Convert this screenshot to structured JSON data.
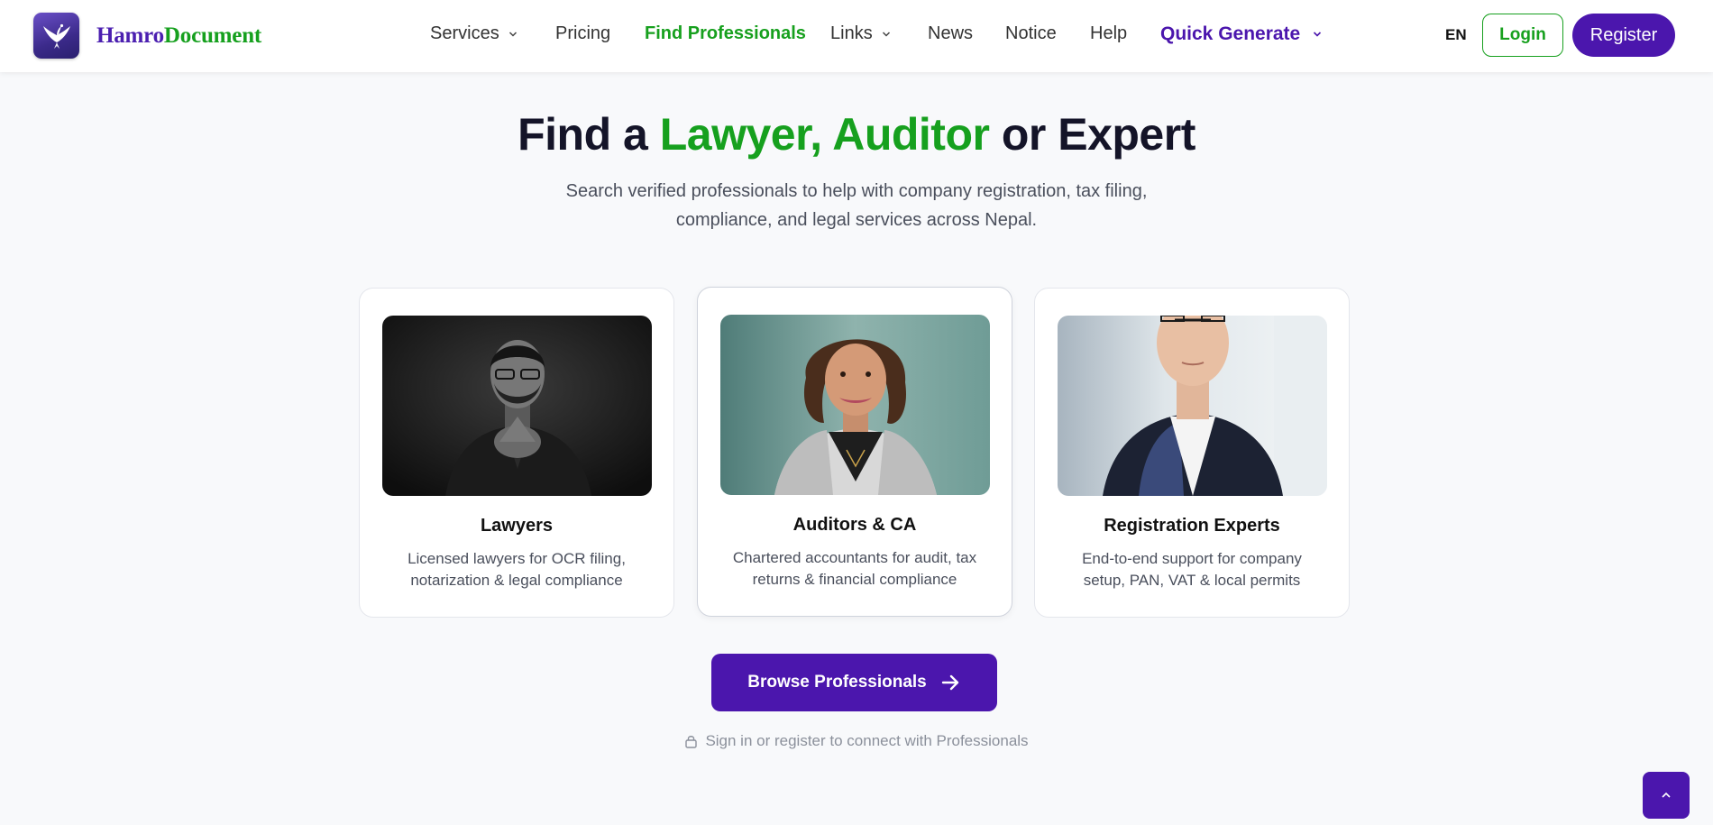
{
  "brand": {
    "name_part1": "Hamro",
    "name_part2": "Document"
  },
  "nav": {
    "services": "Services",
    "pricing": "Pricing",
    "find_professionals": "Find Professionals",
    "links": "Links",
    "news": "News",
    "notice": "Notice",
    "help": "Help",
    "quick_generate": "Quick Generate"
  },
  "header_actions": {
    "language": "EN",
    "login": "Login",
    "register": "Register"
  },
  "hero": {
    "title_part1": "Find a ",
    "title_highlight": "Lawyer, Auditor",
    "title_part2": " or Expert",
    "subtitle": "Search verified professionals to help with company registration, tax filing, compliance, and legal services across Nepal."
  },
  "cards": [
    {
      "title": "Lawyers",
      "description": "Licensed lawyers for OCR filing, notarization & legal compliance"
    },
    {
      "title": "Auditors & CA",
      "description": "Chartered accountants for audit, tax returns & financial compliance"
    },
    {
      "title": "Registration Experts",
      "description": "End-to-end support for company setup, PAN, VAT & local permits"
    }
  ],
  "cta": {
    "browse": "Browse Professionals",
    "signin_note": "Sign in or register to connect with Professionals"
  },
  "colors": {
    "primary": "#4b16ad",
    "accent_green": "#16a01e",
    "background": "#f8f9fb"
  },
  "icons": [
    "chevron-down-icon",
    "arrow-right-icon",
    "lock-icon",
    "chevron-up-icon"
  ]
}
